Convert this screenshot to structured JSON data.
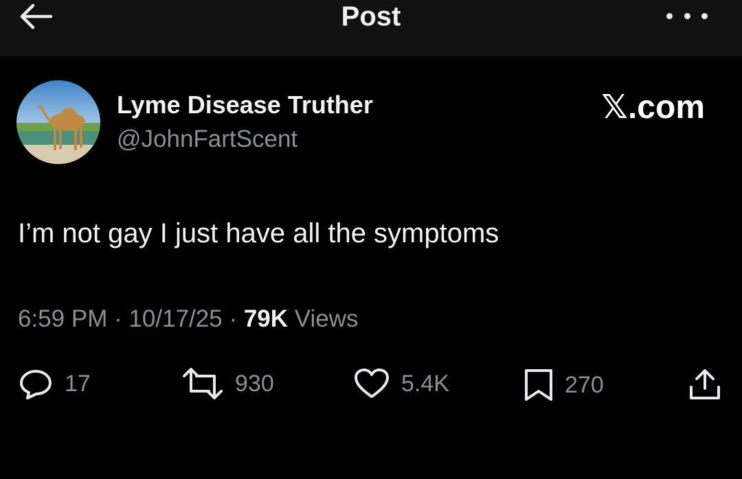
{
  "header": {
    "title": "Post",
    "back_icon": "arrow-left-icon",
    "more_icon": "more-horizontal-icon"
  },
  "post": {
    "author_name": "Lyme Disease Truther",
    "author_handle": "@JohnFartScent",
    "avatar": "camel-avatar-image",
    "watermark": "𝕏.com",
    "text": "I’m not gay I just have all the symptoms",
    "time": "6:59 PM",
    "sep1": " · ",
    "date": "10/17/25",
    "sep2": " · ",
    "views_count": "79K",
    "views_label": " Views"
  },
  "actions": {
    "reply_count": "17",
    "repost_count": "930",
    "like_count": "5.4K",
    "bookmark_count": "270"
  },
  "colors": {
    "background": "#000000",
    "header_bg": "#111111",
    "primary_text": "#e7e9ea",
    "secondary_text": "#8b8f94"
  }
}
